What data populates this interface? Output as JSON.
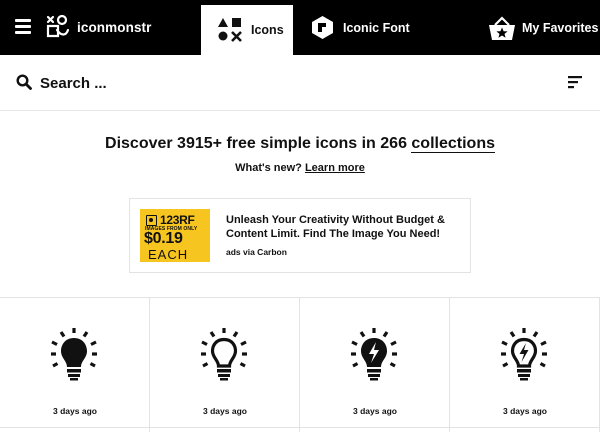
{
  "nav": {
    "brand": "iconmonstr",
    "tabs": [
      {
        "label": "Icons",
        "active": true
      },
      {
        "label": "Iconic Font",
        "active": false
      },
      {
        "label": "My Favorites",
        "active": false
      }
    ]
  },
  "search": {
    "placeholder": "Search ..."
  },
  "hero": {
    "prefix": "Discover 3915+ free simple icons in 266 ",
    "link": "collections",
    "whatsnew_prefix": "What's new? ",
    "whatsnew_link": "Learn more"
  },
  "ad": {
    "brand": "123RF",
    "from_text": "IMAGES FROM ONLY",
    "price": "$0.19",
    "each": "EACH",
    "title": "Unleash Your Creativity Without Budget & Content Limit. Find The Image You Need!",
    "via": "ads via Carbon",
    "accent": "#f7c520"
  },
  "icons": [
    {
      "icon": "lightbulb-filled-icon",
      "date": "3 days ago"
    },
    {
      "icon": "lightbulb-outline-icon",
      "date": "3 days ago"
    },
    {
      "icon": "lightbulb-bolt-filled-icon",
      "date": "3 days ago"
    },
    {
      "icon": "lightbulb-bolt-outline-icon",
      "date": "3 days ago"
    }
  ]
}
